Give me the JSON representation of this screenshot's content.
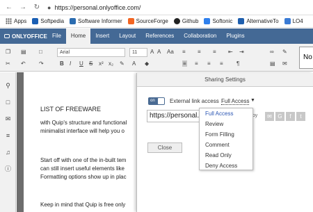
{
  "browser": {
    "back": "←",
    "forward": "→",
    "reload": "↻",
    "lock": "🔒",
    "url": "https://personal.onlyoffice.com/"
  },
  "bookmarks": [
    {
      "label": "Apps",
      "color": "#555555"
    },
    {
      "label": "Softpedia",
      "color": "#1a5fb4"
    },
    {
      "label": "Software Informer",
      "color": "#2b6cb0"
    },
    {
      "label": "SourceForge",
      "color": "#f26522"
    },
    {
      "label": "Github",
      "color": "#222222"
    },
    {
      "label": "Softonic",
      "color": "#2f80ed"
    },
    {
      "label": "AlternativeTo",
      "color": "#1f5fae"
    },
    {
      "label": "LO4",
      "color": "#3a7bd5"
    }
  ],
  "app": {
    "logo": "ONLYOFFICE",
    "tabs": [
      "File",
      "Home",
      "Insert",
      "Layout",
      "References",
      "Collaboration",
      "Plugins"
    ],
    "active_tab": "Home"
  },
  "toolbar": {
    "font": "Arial",
    "size": "11",
    "style_preview": "No"
  },
  "document": {
    "lines": [
      "LIST OF FREEWARE",
      "with Quip's structure and functional",
      "minimalist interface will help you o",
      "Start off with one of the in-built tem",
      "can still insert useful elements like",
      "Formatting options show up in plac",
      "Keep in mind that Quip is free only"
    ]
  },
  "dialog": {
    "title": "Sharing Settings",
    "toggle": "on",
    "external_link_label": "External link access",
    "access_value": "Full Access",
    "link_value": "https://personal.",
    "copy_label": "opy",
    "close_label": "Close",
    "access_options": [
      "Full Access",
      "Review",
      "Form Filling",
      "Comment",
      "Read Only",
      "Deny Access"
    ]
  },
  "colors": {
    "header": "#446995",
    "accent": "#2a55b3"
  }
}
